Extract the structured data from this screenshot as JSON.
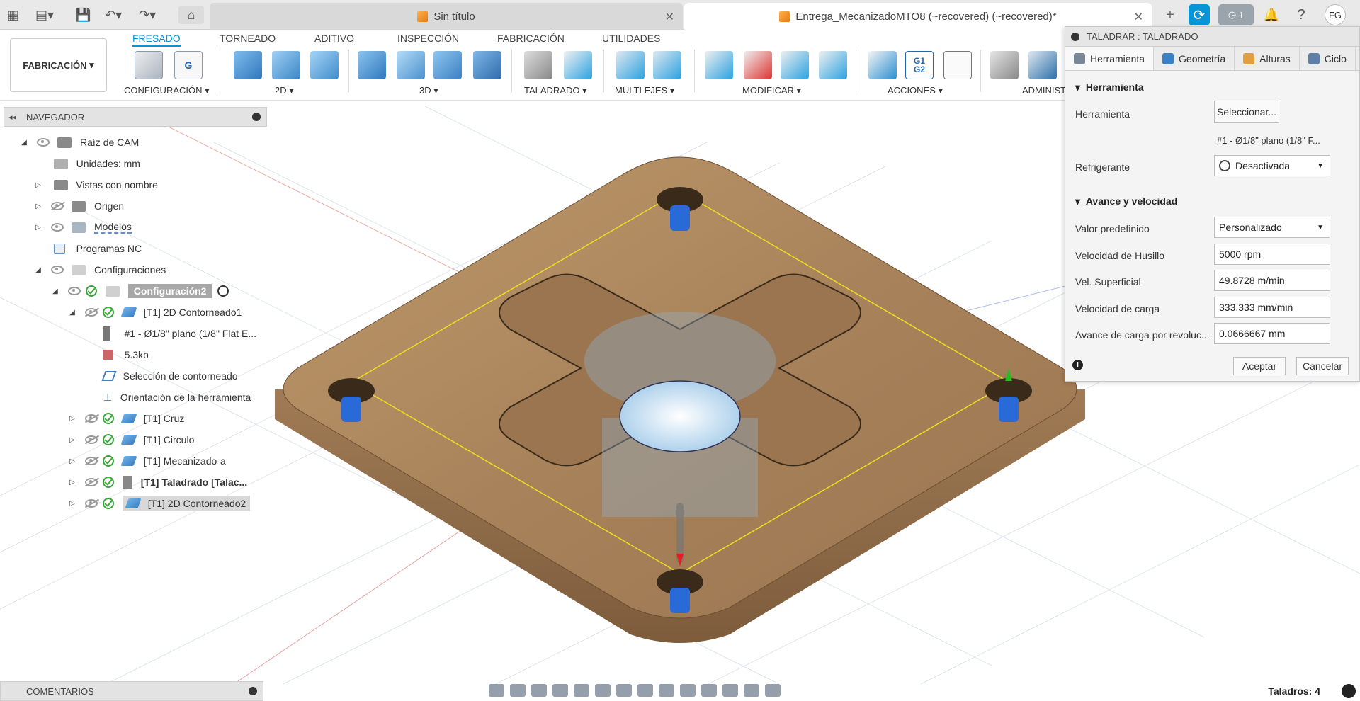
{
  "topbar": {
    "tabs": [
      {
        "label": "Sin título"
      },
      {
        "label": "Entrega_MecanizadoMTO8 (~recovered) (~recovered)*"
      }
    ],
    "jobs_count": "1",
    "user_initials": "FG"
  },
  "ribbon": {
    "workspace": "FABRICACIÓN",
    "tabs": [
      "FRESADO",
      "TORNEADO",
      "ADITIVO",
      "INSPECCIÓN",
      "FABRICACIÓN",
      "UTILIDADES"
    ],
    "groups": [
      "CONFIGURACIÓN ▾",
      "2D ▾",
      "3D ▾",
      "TALADRADO ▾",
      "MULTI EJES ▾",
      "MODIFICAR ▾",
      "ACCIONES ▾",
      "ADMINIST"
    ]
  },
  "navigator": {
    "title": "NAVEGADOR",
    "rows": [
      {
        "label": "Raíz de CAM"
      },
      {
        "label": "Unidades: mm"
      },
      {
        "label": "Vistas con nombre"
      },
      {
        "label": "Origen"
      },
      {
        "label": "Modelos"
      },
      {
        "label": "Programas NC"
      },
      {
        "label": "Configuraciones"
      },
      {
        "label": "Configuración2"
      },
      {
        "label": "[T1] 2D Contorneado1"
      },
      {
        "label": "#1 - Ø1/8\" plano (1/8\" Flat E..."
      },
      {
        "label": "5.3kb"
      },
      {
        "label": "Selección de contorneado"
      },
      {
        "label": "Orientación de la herramienta"
      },
      {
        "label": "[T1] Cruz"
      },
      {
        "label": "[T1] Circulo"
      },
      {
        "label": "[T1] Mecanizado-a"
      },
      {
        "label": "[T1] Taladrado [Talac..."
      },
      {
        "label": "[T1] 2D Contorneado2"
      }
    ]
  },
  "comments": {
    "title": "COMENTARIOS"
  },
  "status": {
    "drills": "Taladros: 4"
  },
  "panel": {
    "title": "TALADRAR : TALADRADO",
    "tabs": [
      "Herramienta",
      "Geometría",
      "Alturas",
      "Ciclo"
    ],
    "tool_section": "Herramienta",
    "tool_label": "Herramienta",
    "select_btn": "Seleccionar...",
    "tool_name": "#1 - Ø1/8\" plano (1/8\" F...",
    "coolant_label": "Refrigerante",
    "coolant_value": "Desactivada",
    "feed_section": "Avance y velocidad",
    "preset_label": "Valor predefinido",
    "preset_value": "Personalizado",
    "spindle_label": "Velocidad de Husillo",
    "spindle_value": "5000 rpm",
    "surface_label": "Vel. Superficial",
    "surface_value": "49.8728 m/min",
    "plunge_label": "Velocidad de carga",
    "plunge_value": "333.333 mm/min",
    "plunge_rev_label": "Avance de carga por revoluc...",
    "plunge_rev_value": "0.0666667 mm",
    "ok": "Aceptar",
    "cancel": "Cancelar"
  }
}
